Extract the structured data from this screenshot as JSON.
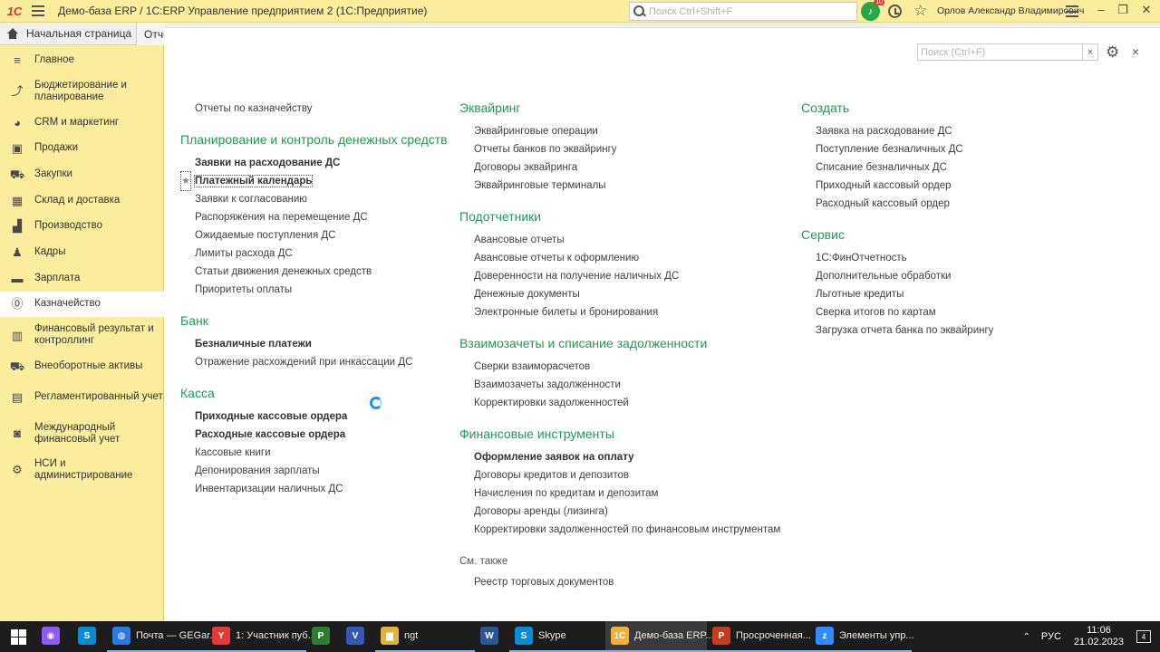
{
  "titlebar": {
    "logo": "1С",
    "title": "Демо-база ERP / 1С:ERP Управление предприятием 2  (1С:Предприятие)",
    "search_placeholder": "Поиск Ctrl+Shift+F",
    "notification_count": "10",
    "user": "Орлов Александр Владимирович",
    "minimize": "–",
    "restore": "❐",
    "close": "✕"
  },
  "tabs": {
    "home": "Начальная страница",
    "other": "Отчет"
  },
  "sidebar": {
    "items": [
      {
        "label": "Главное",
        "icon": "≡"
      },
      {
        "label": "Бюджетирование и планирование",
        "icon": "⤴"
      },
      {
        "label": "CRM и маркетинг",
        "icon": "◕"
      },
      {
        "label": "Продажи",
        "icon": "▣"
      },
      {
        "label": "Закупки",
        "icon": "⛟"
      },
      {
        "label": "Склад и доставка",
        "icon": "▦"
      },
      {
        "label": "Производство",
        "icon": "▟"
      },
      {
        "label": "Кадры",
        "icon": "♟"
      },
      {
        "label": "Зарплата",
        "icon": "▬"
      },
      {
        "label": "Казначейство",
        "icon": "⓪"
      },
      {
        "label": "Финансовый результат и контроллинг",
        "icon": "▥"
      },
      {
        "label": "Внеоборотные активы",
        "icon": "⛟"
      },
      {
        "label": "Регламентированный учет",
        "icon": "▤"
      },
      {
        "label": "Международный финансовый учет",
        "icon": "◙"
      },
      {
        "label": "НСИ и администрирование",
        "icon": "⚙"
      }
    ],
    "active_index": 9
  },
  "panel": {
    "search_placeholder": "Поиск (Ctrl+F)",
    "clear": "×",
    "gear": "⚙",
    "close": "×"
  },
  "col1": {
    "top_link": "Отчеты по казначейству",
    "planning_title": "Планирование и контроль денежных средств",
    "planning": [
      "Заявки на расходование ДС",
      "Платежный календарь",
      "Заявки к согласованию",
      "Распоряжения на перемещение ДС",
      "Ожидаемые поступления ДС",
      "Лимиты расхода ДС",
      "Статьи движения денежных средств",
      "Приоритеты оплаты"
    ],
    "bank_title": "Банк",
    "bank": [
      "Безналичные платежи",
      "Отражение расхождений при инкассации ДС"
    ],
    "cash_title": "Касса",
    "cash": [
      "Приходные кассовые ордера",
      "Расходные кассовые ордера",
      "Кассовые книги",
      "Депонирования зарплаты",
      "Инвентаризации наличных ДС"
    ],
    "fav_mark": "★"
  },
  "col2": {
    "acquiring_title": "Эквайринг",
    "acquiring": [
      "Эквайринговые операции",
      "Отчеты банков по эквайрингу",
      "Договоры эквайринга",
      "Эквайринговые терминалы"
    ],
    "accountable_title": "Подотчетники",
    "accountable": [
      "Авансовые отчеты",
      "Авансовые отчеты к оформлению",
      "Доверенности на получение наличных ДС",
      "Денежные документы",
      "Электронные билеты и бронирования"
    ],
    "settlements_title": "Взаимозачеты и списание задолженности",
    "settlements": [
      "Сверки взаиморасчетов",
      "Взаимозачеты задолженности",
      "Корректировки задолженностей"
    ],
    "fin_title": "Финансовые инструменты",
    "fin": [
      "Оформление заявок на оплату",
      "Договоры кредитов и депозитов",
      "Начисления по кредитам и депозитам",
      "Договоры аренды (лизинга)",
      "Корректировки задолженностей по финансовым инструментам"
    ],
    "see_also": "См. также",
    "see_also_links": [
      "Реестр торговых документов"
    ]
  },
  "col3": {
    "create_title": "Создать",
    "create": [
      "Заявка на расходование ДС",
      "Поступление безналичных ДС",
      "Списание безналичных ДС",
      "Приходный кассовый ордер",
      "Расходный кассовый ордер"
    ],
    "service_title": "Сервис",
    "service": [
      "1С:ФинОтчетность",
      "Дополнительные обработки",
      "Льготные кредиты",
      "Сверка итогов по картам",
      "Загрузка отчета банка по эквайрингу"
    ]
  },
  "taskbar": {
    "items": [
      {
        "label": "",
        "icon": "◉",
        "color": "#8a5cf6"
      },
      {
        "label": "",
        "icon": "S",
        "color": "#0a8bd6"
      },
      {
        "label": "Почта — GEGar...",
        "icon": "◍",
        "color": "#2a7ae2"
      },
      {
        "label": "1: Участник пуб...",
        "icon": "Y",
        "color": "#e53935"
      },
      {
        "label": "",
        "icon": "P",
        "color": "#2e7d32"
      },
      {
        "label": "",
        "icon": "V",
        "color": "#3558b5"
      },
      {
        "label": "ngt",
        "icon": "▆",
        "color": "#e0b43c"
      },
      {
        "label": "",
        "icon": "W",
        "color": "#2b579a"
      },
      {
        "label": "Skype",
        "icon": "S",
        "color": "#0a8bd6"
      },
      {
        "label": "Демо-база ERP...",
        "icon": "1С",
        "color": "#f2b134"
      },
      {
        "label": "Просроченная...",
        "icon": "P",
        "color": "#c43e1c"
      },
      {
        "label": "Элементы упр...",
        "icon": "z",
        "color": "#2d8cff"
      }
    ],
    "active_index": 9,
    "lang": "РУС",
    "time": "11:06",
    "date": "21.02.2023",
    "notif": "4"
  }
}
